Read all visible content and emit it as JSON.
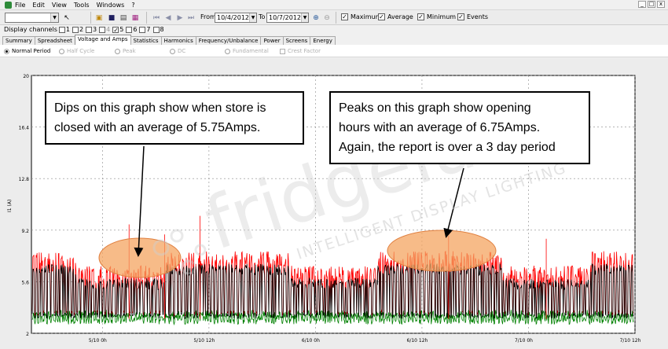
{
  "menu": {
    "items": [
      "File",
      "Edit",
      "View",
      "Tools",
      "Windows",
      "?"
    ],
    "window_buttons": [
      "_",
      "□",
      "x"
    ]
  },
  "toolbar": {
    "from_label": "From",
    "from_date": "10/4/2012",
    "to_label": "To",
    "to_date": "10/7/2012",
    "checkboxes": [
      {
        "label": "Maximum",
        "checked": true
      },
      {
        "label": "Average",
        "checked": true
      },
      {
        "label": "Minimum",
        "checked": true
      },
      {
        "label": "Events",
        "checked": true
      }
    ]
  },
  "channels": {
    "label": "Display channels",
    "items": [
      {
        "label": "1",
        "checked": false,
        "enabled": true
      },
      {
        "label": "2",
        "checked": false,
        "enabled": true
      },
      {
        "label": "3",
        "checked": false,
        "enabled": true
      },
      {
        "label": "4",
        "checked": false,
        "enabled": false
      },
      {
        "label": "5",
        "checked": true,
        "enabled": true
      },
      {
        "label": "6",
        "checked": false,
        "enabled": true
      },
      {
        "label": "7",
        "checked": false,
        "enabled": true
      },
      {
        "label": "8",
        "checked": false,
        "enabled": true
      }
    ]
  },
  "tabs": {
    "items": [
      "Summary",
      "Spreadsheet",
      "Voltage and Amps",
      "Statistics",
      "Harmonics",
      "Frequency/Unbalance",
      "Power",
      "Screens",
      "Energy"
    ],
    "active": "Voltage and Amps"
  },
  "period": {
    "normal": "Normal Period",
    "half": "Half Cycle",
    "peak": "Peak",
    "dc": "DC",
    "fundamental": "Fundamental",
    "crest": "Crest Factor",
    "selected": "Normal Period"
  },
  "callouts": {
    "left": [
      "Dips on this graph show when store is",
      "closed with an average of 5.75Amps."
    ],
    "right": [
      "Peaks on this graph show opening",
      "hours with an average of 6.75Amps.",
      "Again, the report is over a 3 day period"
    ]
  },
  "watermark": {
    "brand": "fridgelux",
    "tagline": "INTELLIGENT DISPLAY LIGHTING"
  },
  "chart_data": {
    "type": "line",
    "ylabel": "I1 (A)",
    "ylim": [
      2,
      20
    ],
    "yticks": [
      "2",
      "5.6",
      "9.2",
      "12.8",
      "16.4",
      "20"
    ],
    "xticks": [
      "5/10 0h",
      "5/10 12h",
      "6/10 0h",
      "6/10 12h",
      "7/10 0h",
      "7/10 12h"
    ],
    "xlim_hours": [
      -8,
      60
    ],
    "grid": true,
    "series": [
      {
        "color": "#ff0000"
      },
      {
        "color": "#000000"
      },
      {
        "color": "#008000"
      }
    ],
    "baseline_low": 3.0,
    "open_high_avg": 6.75,
    "closed_high_avg": 5.75
  }
}
